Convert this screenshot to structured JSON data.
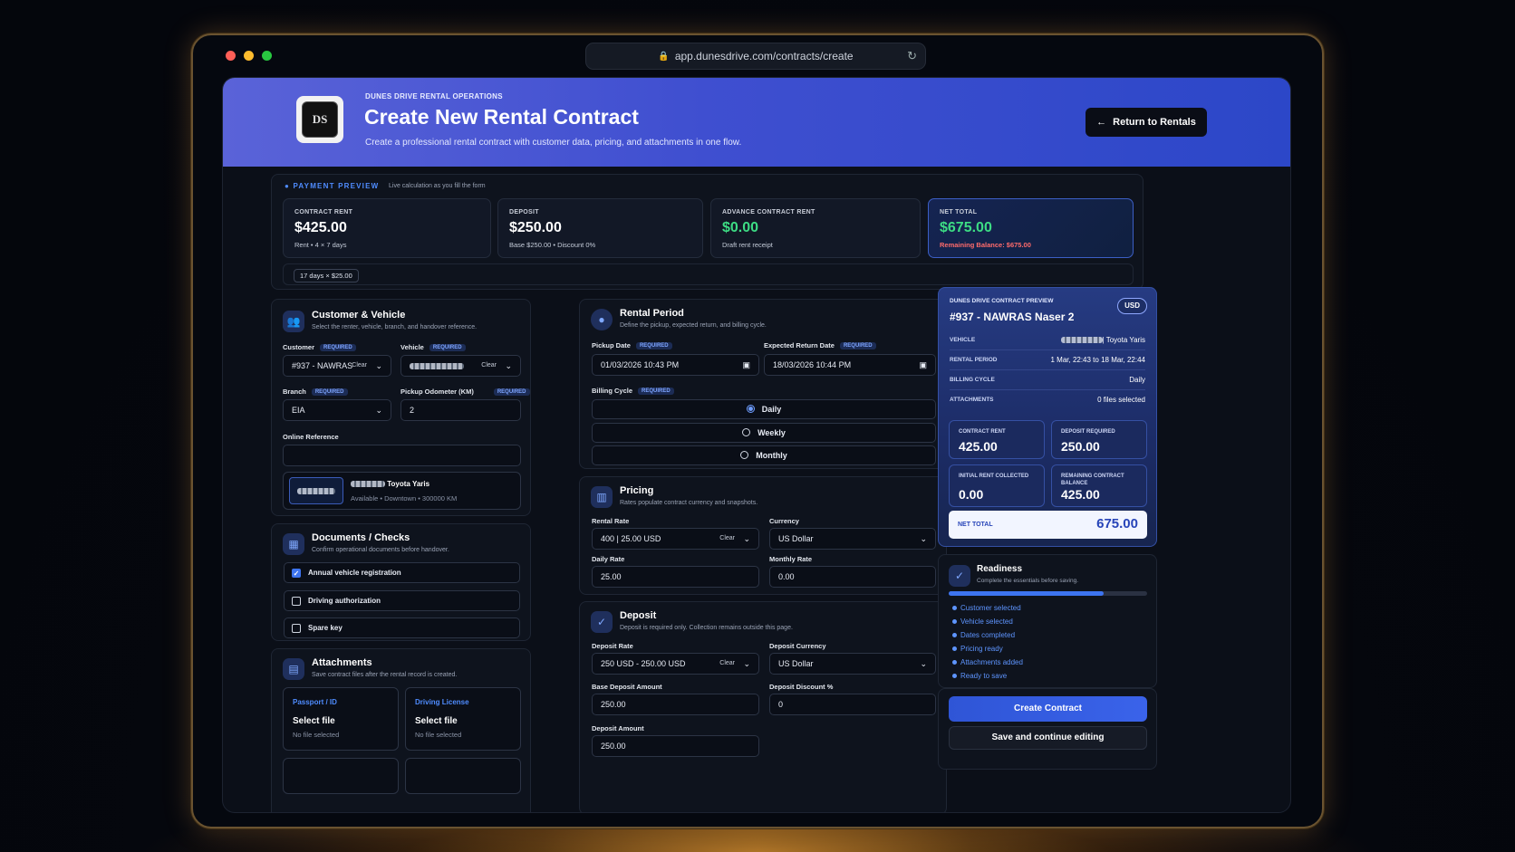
{
  "browser": {
    "url": "app.dunesdrive.com/contracts/create"
  },
  "header": {
    "logo_text": "DS",
    "eyebrow": "DUNES DRIVE RENTAL OPERATIONS",
    "title": "Create New Rental Contract",
    "subtitle": "Create a professional rental contract with customer data, pricing, and attachments in one flow.",
    "return_button": "Return to Rentals"
  },
  "payment_preview": {
    "label": "PAYMENT PREVIEW",
    "note": "Live calculation as you fill the form",
    "stats": [
      {
        "label": "CONTRACT RENT",
        "value": "$425.00",
        "sub": "Rent • 4 × 7 days"
      },
      {
        "label": "DEPOSIT",
        "value": "$250.00",
        "sub": "Base $250.00 • Discount 0%"
      },
      {
        "label": "ADVANCE CONTRACT RENT",
        "value": "$0.00",
        "sub": "Draft rent receipt"
      },
      {
        "label": "NET TOTAL",
        "value": "$675.00",
        "sub": "Remaining Balance: $675.00"
      }
    ],
    "chip": "17 days × $25.00"
  },
  "customer_vehicle": {
    "title": "Customer & Vehicle",
    "subtitle": "Select the renter, vehicle, branch, and handover reference.",
    "customer_label": "Customer",
    "customer_value": "#937 - NAWRAS",
    "vehicle_label": "Vehicle",
    "branch_label": "Branch",
    "branch_value": "EIA",
    "odometer_label": "Pickup Odometer (KM)",
    "odometer_value": "2",
    "online_ref_label": "Online Reference",
    "online_ref_value": "",
    "vehicle_card_name": "Toyota Yaris",
    "vehicle_card_meta": "Available • Downtown • 300000 KM",
    "required": "REQUIRED",
    "clear": "Clear"
  },
  "documents": {
    "title": "Documents / Checks",
    "subtitle": "Confirm operational documents before handover.",
    "items": [
      {
        "label": "Annual vehicle registration",
        "checked": true
      },
      {
        "label": "Driving authorization",
        "checked": false
      },
      {
        "label": "Spare key",
        "checked": false
      }
    ]
  },
  "attachments": {
    "title": "Attachments",
    "subtitle": "Save contract files after the rental record is created.",
    "items": [
      {
        "type": "Passport / ID",
        "button": "Select file",
        "status": "No file selected"
      },
      {
        "type": "Driving License",
        "button": "Select file",
        "status": "No file selected"
      }
    ]
  },
  "rental_period": {
    "title": "Rental Period",
    "subtitle": "Define the pickup, expected return, and billing cycle.",
    "pickup_label": "Pickup Date",
    "pickup_value": "01/03/2026 10:43 PM",
    "return_label": "Expected Return Date",
    "return_value": "18/03/2026 10:44 PM",
    "billing_label": "Billing Cycle",
    "options": [
      {
        "label": "Daily",
        "selected": true
      },
      {
        "label": "Weekly",
        "selected": false
      },
      {
        "label": "Monthly",
        "selected": false
      }
    ]
  },
  "pricing": {
    "title": "Pricing",
    "subtitle": "Rates populate contract currency and snapshots.",
    "rental_rate_label": "Rental Rate",
    "rental_rate_value": "400 | 25.00 USD",
    "currency_label": "Currency",
    "currency_value": "US Dollar",
    "daily_rate_label": "Daily Rate",
    "daily_rate_value": "25.00",
    "monthly_rate_label": "Monthly Rate",
    "monthly_rate_value": "0.00"
  },
  "deposit": {
    "title": "Deposit",
    "subtitle": "Deposit is required only. Collection remains outside this page.",
    "rate_label": "Deposit Rate",
    "rate_value": "250 USD - 250.00 USD",
    "currency_label": "Deposit Currency",
    "currency_value": "US Dollar",
    "base_label": "Base Deposit Amount",
    "base_value": "250.00",
    "discount_label": "Deposit Discount %",
    "discount_value": "0",
    "amount_label": "Deposit Amount",
    "amount_value": "250.00"
  },
  "contract_preview": {
    "eyebrow": "DUNES DRIVE CONTRACT PREVIEW",
    "title": "#937 - NAWRAS Naser 2",
    "currency": "USD",
    "rows": [
      {
        "key": "VEHICLE",
        "value": "| Toyota Yaris"
      },
      {
        "key": "RENTAL PERIOD",
        "value": "1 Mar, 22:43 to 18 Mar, 22:44"
      },
      {
        "key": "BILLING CYCLE",
        "value": "Daily"
      },
      {
        "key": "ATTACHMENTS",
        "value": "0 files selected"
      }
    ],
    "boxes": [
      {
        "key": "CONTRACT RENT",
        "value": "425.00"
      },
      {
        "key": "DEPOSIT REQUIRED",
        "value": "250.00"
      },
      {
        "key": "INITIAL RENT COLLECTED",
        "value": "0.00"
      },
      {
        "key": "REMAINING CONTRACT BALANCE",
        "value": "425.00"
      }
    ],
    "net_label": "NET TOTAL",
    "net_value": "675.00"
  },
  "readiness": {
    "title": "Readiness",
    "subtitle": "Complete the essentials before saving.",
    "progress": 0.78,
    "items": [
      "Customer selected",
      "Vehicle selected",
      "Dates completed",
      "Pricing ready",
      "Attachments added",
      "Ready to save"
    ]
  },
  "actions": {
    "create": "Create Contract",
    "save": "Save and continue editing"
  },
  "colors": {
    "accent": "#3d6ef0",
    "positive": "#3ddc84",
    "warning": "#ff6b6b"
  }
}
